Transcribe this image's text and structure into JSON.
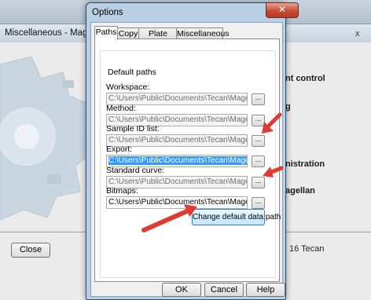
{
  "background_window": {
    "title": "Miscellaneous - Magellan Tra",
    "close_glyph": "x",
    "side_items": [
      "nt control",
      "g",
      "nistration",
      "agellan"
    ],
    "close_button_label": "Close",
    "copyright": "16 Tecan"
  },
  "dialog": {
    "title": "Options",
    "close_glyph": "✕",
    "tabs": [
      "Paths",
      "Copy",
      "Plate View",
      "Miscellaneous"
    ],
    "active_tab": "Paths",
    "group_title": "Default paths",
    "fields": [
      {
        "label": "Workspace:",
        "value": "C:\\Users\\Public\\Documents\\Tecan\\Magellan\\wsp",
        "enabled": false
      },
      {
        "label": "Method:",
        "value": "C:\\Users\\Public\\Documents\\Tecan\\Magellan\\mth",
        "enabled": false
      },
      {
        "label": "Sample ID list:",
        "value": "C:\\Users\\Public\\Documents\\Tecan\\Magellan\\smp",
        "enabled": false
      },
      {
        "label": "Export:",
        "value": "C:\\Users\\Public\\Documents\\Tecan\\Magellan\\asc",
        "enabled": true,
        "selected": true
      },
      {
        "label": "Standard curve:",
        "value": "C:\\Users\\Public\\Documents\\Tecan\\Magellan\\wsp",
        "enabled": false
      },
      {
        "label": "Bitmaps:",
        "value": "C:\\Users\\Public\\Documents\\Tecan\\Magellan",
        "enabled": true
      }
    ],
    "browse_label": "...",
    "change_button_label": "Change default data path",
    "buttons": {
      "ok": "OK",
      "cancel": "Cancel",
      "help": "Help"
    }
  },
  "colors": {
    "arrow": "#e03b32",
    "selection": "#3399ff",
    "dialog_frame": "#b9cfe4"
  }
}
